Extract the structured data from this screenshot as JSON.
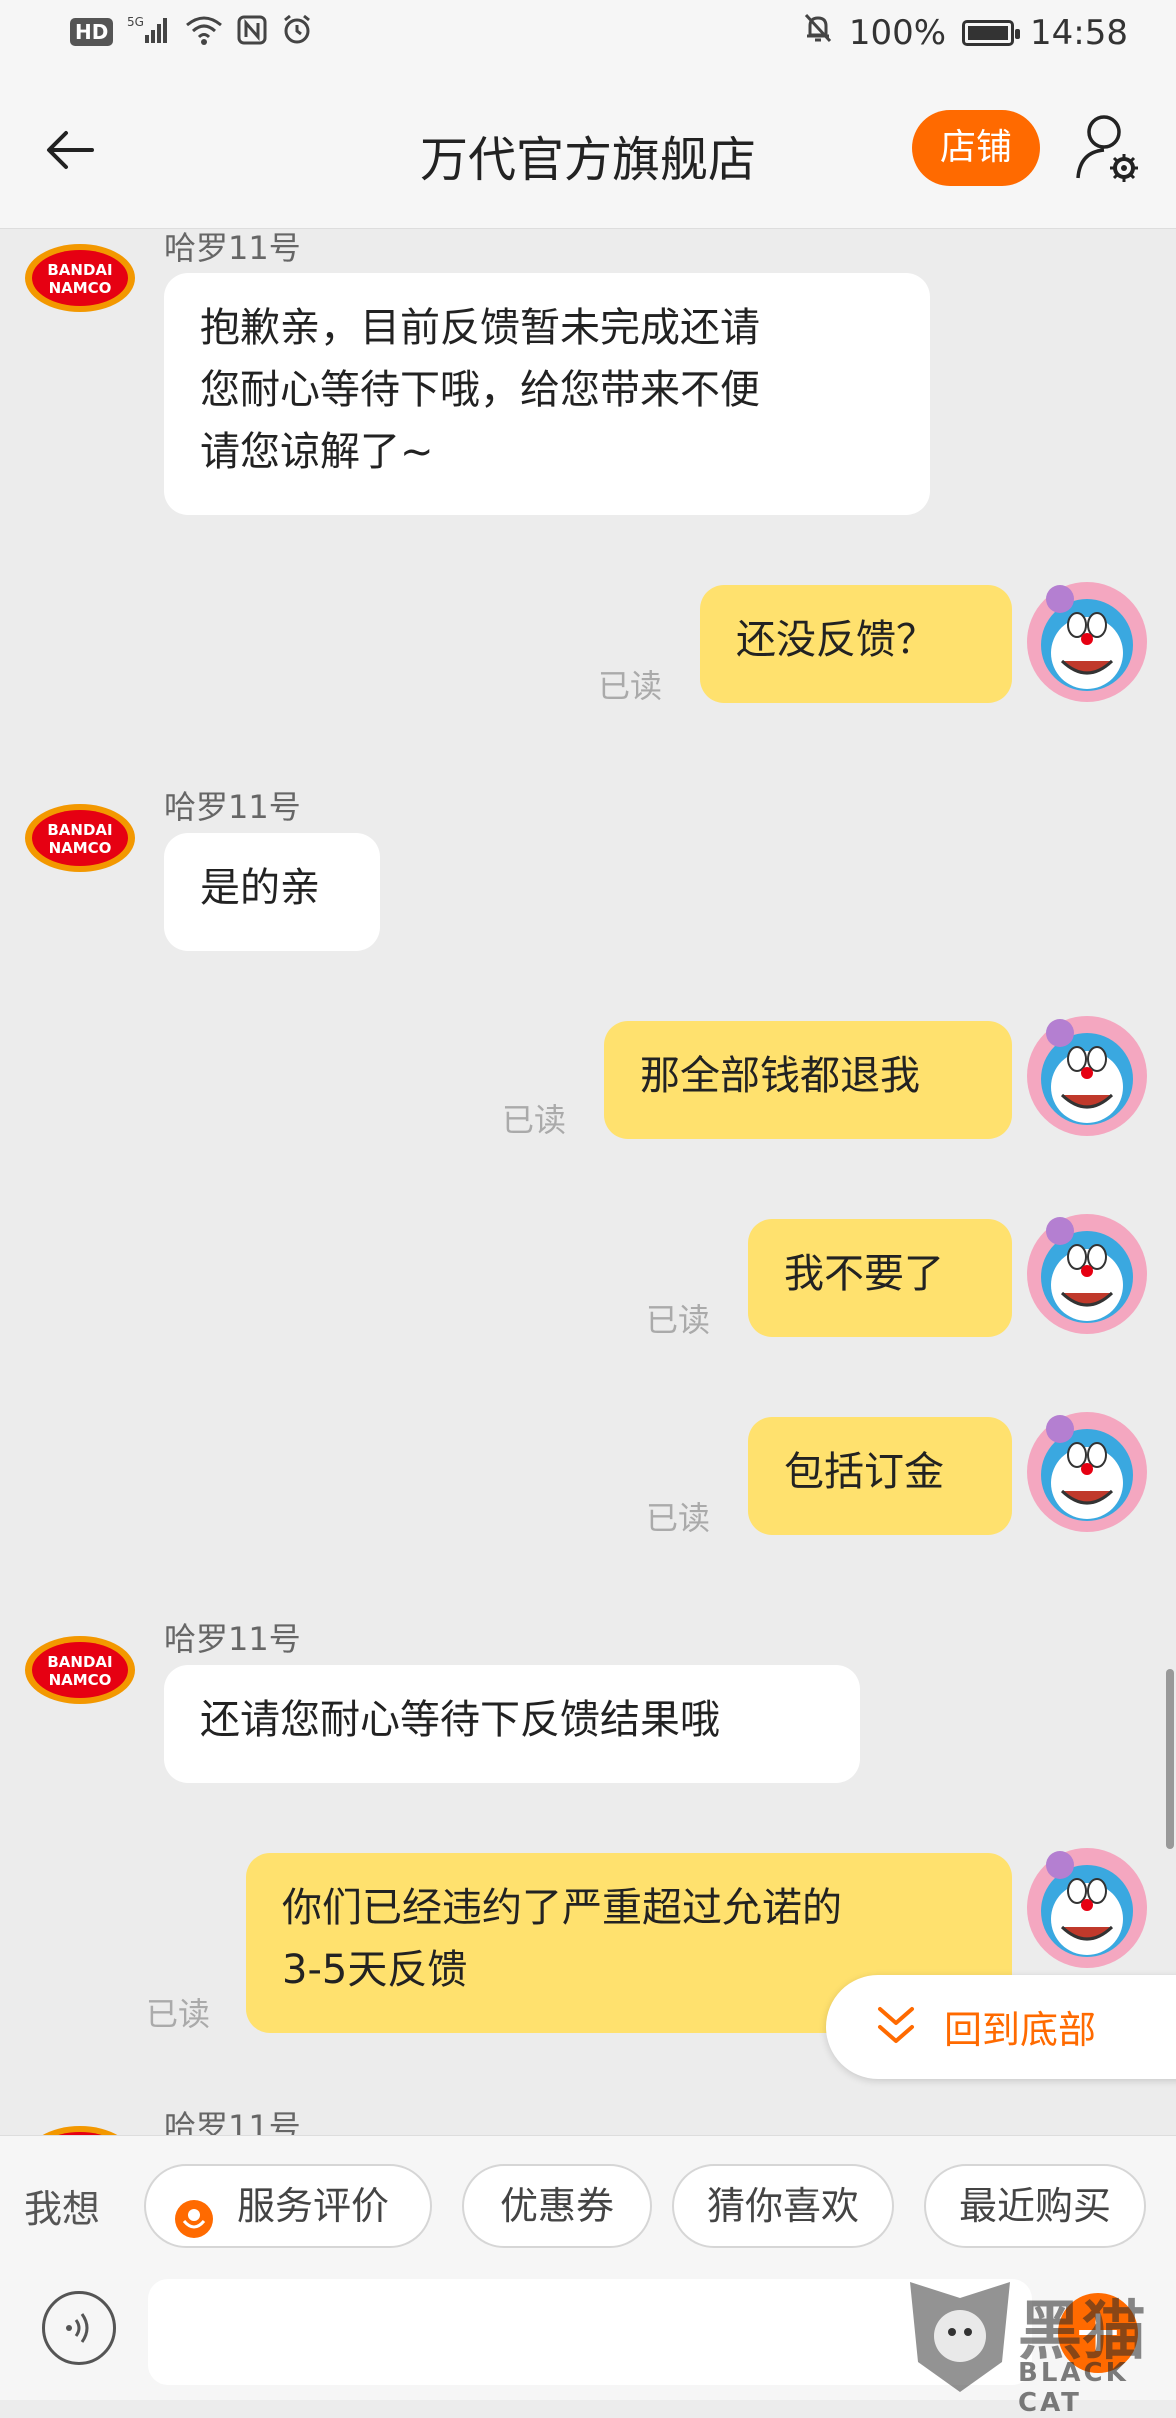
{
  "status_bar": {
    "hd": "HD",
    "network": "5G",
    "battery": "100%",
    "time": "14:58"
  },
  "header": {
    "title": "万代官方旗舰店",
    "shop_button": "店铺"
  },
  "messages": [
    {
      "side": "left",
      "sender": "哈罗11号",
      "text": "抱歉亲，目前反馈暂未完成还请\n您耐心等待下哦，给您带来不便\n请您谅解了~"
    },
    {
      "side": "right",
      "text": "还没反馈？",
      "read": "已读"
    },
    {
      "side": "left",
      "sender": "哈罗11号",
      "text": "是的亲"
    },
    {
      "side": "right",
      "text": "那全部钱都退我",
      "read": "已读"
    },
    {
      "side": "right",
      "text": "我不要了",
      "read": "已读"
    },
    {
      "side": "right",
      "text": "包括订金",
      "read": "已读"
    },
    {
      "side": "left",
      "sender": "哈罗11号",
      "text": "还请您耐心等待下反馈结果哦"
    },
    {
      "side": "right",
      "text": "你们已经违约了严重超过允诺的\n3-5天反馈",
      "read": "已读"
    },
    {
      "side": "left",
      "sender": "哈罗11号",
      "text": ""
    }
  ],
  "avatars": {
    "shop_logo_line1": "BANDAI",
    "shop_logo_line2": "NAMCO"
  },
  "back_to_bottom": "回到底部",
  "quick_bar": {
    "label": "我想",
    "chips": [
      "服务评价",
      "优惠券",
      "猜你喜欢",
      "最近购买"
    ]
  },
  "watermark": {
    "big": "黑猫",
    "small": "BLACK CAT"
  },
  "colors": {
    "accent": "#ff6a00",
    "user_bubble": "#ffe16e",
    "shop_bubble": "#ffffff",
    "background": "#ececec"
  }
}
